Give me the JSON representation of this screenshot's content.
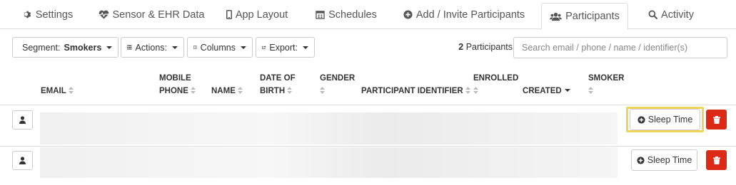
{
  "tabs": [
    {
      "label": "Settings",
      "icon": "gear-icon"
    },
    {
      "label": "Sensor & EHR Data",
      "icon": "heartbeat-icon"
    },
    {
      "label": "App Layout",
      "icon": "mobile-icon"
    },
    {
      "label": "Schedules",
      "icon": "calendar-icon"
    },
    {
      "label": "Add / Invite Participants",
      "icon": "plus-circle-icon"
    },
    {
      "label": "Participants",
      "icon": "users-icon",
      "active": true
    },
    {
      "label": "Activity",
      "icon": "search-icon"
    }
  ],
  "toolbar": {
    "segment_prefix": "Segment:",
    "segment_value": "Smokers",
    "actions_label": "Actions:",
    "columns_label": "Columns",
    "export_label": "Export:",
    "participant_count": "2",
    "participant_count_label": "Participants",
    "search_placeholder": "Search email / phone / name / identifier(s)"
  },
  "table": {
    "headers": {
      "email": "EMAIL",
      "mobile_phone_1": "MOBILE",
      "mobile_phone_2": "PHONE",
      "name": "NAME",
      "dob_1": "DATE OF",
      "dob_2": "BIRTH",
      "gender": "GENDER",
      "identifier": "PARTICIPANT IDENTIFIER",
      "enrolled": "ENROLLED",
      "created": "CREATED",
      "smoker": "SMOKER"
    },
    "rows": [
      {
        "action_label": "Sleep Time",
        "highlighted": true
      },
      {
        "action_label": "Sleep Time",
        "highlighted": false
      }
    ]
  },
  "colors": {
    "delete_button": "#dd2a17",
    "highlight_border": "#f0d45a",
    "border": "#dddddd"
  }
}
